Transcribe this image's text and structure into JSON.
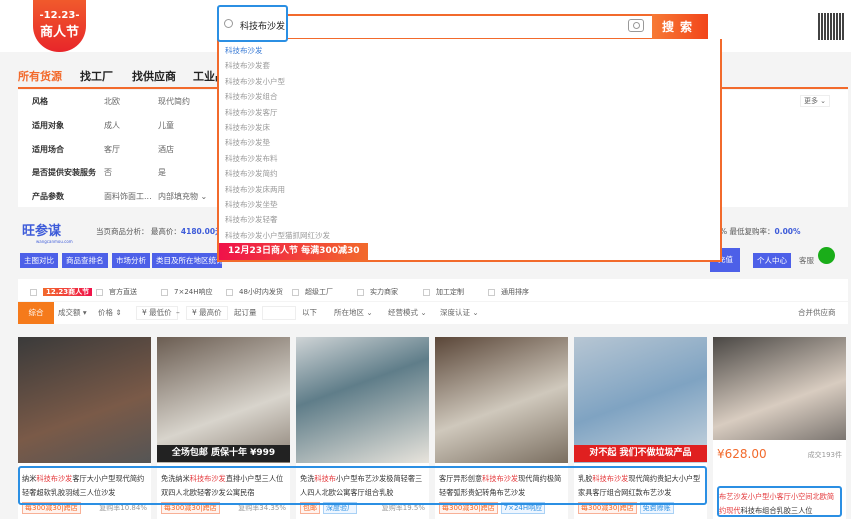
{
  "header": {
    "logo_date": "-12.23-",
    "logo_text": "商人节",
    "search_query": "科技布沙发",
    "search_button": "搜索"
  },
  "nav": {
    "tabs": [
      "所有货源",
      "找工厂",
      "找供应商",
      "工业品"
    ]
  },
  "filters": {
    "rows": [
      {
        "label": "风格",
        "values": [
          "北欧",
          "现代简约"
        ]
      },
      {
        "label": "适用对象",
        "values": [
          "成人",
          "儿童"
        ]
      },
      {
        "label": "适用场合",
        "values": [
          "客厅",
          "酒店"
        ]
      },
      {
        "label": "是否提供安装服务",
        "values": [
          "否",
          "是"
        ]
      },
      {
        "label": "产品参数",
        "values": [
          "面料饰面工...",
          "内部填充物 ⌄"
        ]
      }
    ],
    "more": "更多 ⌄"
  },
  "suggestions": [
    "科技布沙发",
    "科技布沙发套",
    "科技布沙发小户型",
    "科技布沙发组合",
    "科技布沙发客厅",
    "科技布沙发床",
    "科技布沙发垫",
    "科技布沙发布料",
    "科技布沙发简约",
    "科技布沙发床两用",
    "科技布沙发坐垫",
    "科技布沙发轻奢",
    "科技布沙发小户型猫抓网红沙发"
  ],
  "promo_banner": "12月23日商人节  每满300减30",
  "wang": {
    "name": "旺参谋",
    "url": "wangcanmou.com",
    "analysis_label": "当页商品分析：  最高价：",
    "max_price": "4180.00元",
    "min_rebuy_label": "%  最低复购率：",
    "min_rebuy": "0.00%"
  },
  "tool_buttons": [
    "主图对比",
    "商品查排名",
    "市场分析",
    "类目及所在地区统计",
    "充值",
    "个人中心"
  ],
  "kefu": "客服",
  "checks": [
    "12.23商人节",
    "官方直送",
    "7×24H响应",
    "48小时内发货",
    "超级工厂",
    "实力商家",
    "加工定制",
    "通用排序"
  ],
  "sort": {
    "items": [
      "综合",
      "成交额 ▾",
      "价格 ⇕",
      "¥ 最低价",
      "–",
      "¥ 最高价",
      "起订量",
      "以下",
      "所在地区 ⌄",
      "经营模式 ⌄",
      "深度认证 ⌄",
      "合并供应商"
    ]
  },
  "products": [
    {
      "title_parts": [
        "纳米",
        "科技布沙发",
        "客厅大小户型现代简约轻奢超软乳胶羽绒三人位沙发"
      ],
      "tags": [
        "每300减30|跨店"
      ],
      "rate": "复购率10.84%",
      "overlay": ""
    },
    {
      "title_parts": [
        "免洗纳米",
        "科技布沙发",
        "直排小户型三人位双四人北欧轻奢沙发公寓民宿"
      ],
      "tags": [
        "每300减30|跨店"
      ],
      "rate": "复购率34.35%",
      "overlay": "全场包邮 质保十年  ¥999"
    },
    {
      "title_parts": [
        "免洗",
        "科技布",
        "小户型布艺沙发极简轻奢三人四人北欧公寓客厅组合乳胶"
      ],
      "tags": [
        "包邮",
        "深度验厂"
      ],
      "rate": "复购率19.5%",
      "overlay": ""
    },
    {
      "title_parts": [
        "客厅异形创意",
        "科技布沙发",
        "现代简约极简轻奢弧形贵妃转角布艺沙发"
      ],
      "tags": [
        "每300减30|跨店",
        "7×24H响应"
      ],
      "rate": "",
      "overlay": ""
    },
    {
      "title_parts": [
        "乳胶",
        "科技布沙发",
        "现代简约贵妃大小户型家具客厅组合网红款布艺沙发"
      ],
      "tags": [
        "每300减30|跨店",
        "免费赊账"
      ],
      "rate": "",
      "overlay": "对不起 我们不做垃圾产品"
    },
    {
      "title_parts": [
        "布艺沙发",
        "小户型小客厅小空间北欧简约现代",
        "科技布组合乳胶三人位"
      ],
      "price": "¥628.00",
      "sold": "成交193件",
      "tags": [],
      "rate": "",
      "overlay": ""
    }
  ],
  "colors": {
    "accent": "#f26a2c",
    "highlight": "#2b8fe3",
    "tool_blue": "#4d60e8"
  }
}
